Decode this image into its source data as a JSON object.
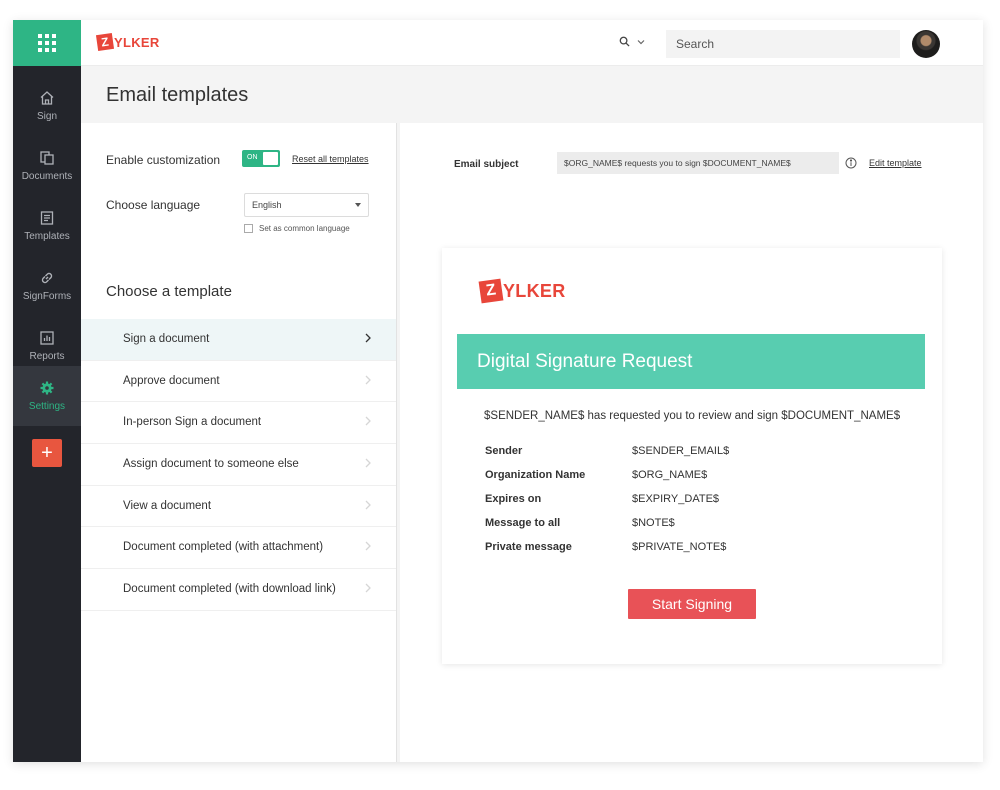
{
  "brand": {
    "logo_letter": "Z",
    "logo_text": "YLKER",
    "accent_green": "#2eb585",
    "accent_red": "#e8463a"
  },
  "sidebar": {
    "apps_icon": "apps-grid-icon",
    "items": [
      {
        "label": "Sign",
        "icon": "home-icon"
      },
      {
        "label": "Documents",
        "icon": "documents-icon"
      },
      {
        "label": "Templates",
        "icon": "templates-icon"
      },
      {
        "label": "SignForms",
        "icon": "link-icon"
      },
      {
        "label": "Reports",
        "icon": "reports-icon"
      },
      {
        "label": "Settings",
        "icon": "gear-icon",
        "active": true
      }
    ],
    "plus_label": "+"
  },
  "topbar": {
    "search_placeholder": "Search"
  },
  "page": {
    "title": "Email templates"
  },
  "left_panel": {
    "enable_label": "Enable customization",
    "toggle_state": "ON",
    "reset_label": "Reset all templates",
    "language_label": "Choose language",
    "language_value": "English",
    "common_language_label": "Set as common language",
    "choose_template_label": "Choose a template",
    "templates": [
      "Sign a document",
      "Approve document",
      "In-person Sign a document",
      "Assign document to someone else",
      "View a document",
      "Document completed (with attachment)",
      "Document completed (with download link)"
    ]
  },
  "right_panel": {
    "subject_label": "Email subject",
    "subject_value": "$ORG_NAME$ requests you to sign $DOCUMENT_NAME$",
    "edit_label": "Edit template",
    "preview": {
      "banner_title": "Digital Signature Request",
      "request_text": "$SENDER_NAME$ has requested you to review and sign $DOCUMENT_NAME$",
      "details": [
        {
          "label": "Sender",
          "value": "$SENDER_EMAIL$"
        },
        {
          "label": "Organization Name",
          "value": "$ORG_NAME$"
        },
        {
          "label": "Expires on",
          "value": "$EXPIRY_DATE$"
        },
        {
          "label": "Message to all",
          "value": "$NOTE$"
        },
        {
          "label": "Private message",
          "value": "$PRIVATE_NOTE$"
        }
      ],
      "button_label": "Start Signing"
    }
  }
}
